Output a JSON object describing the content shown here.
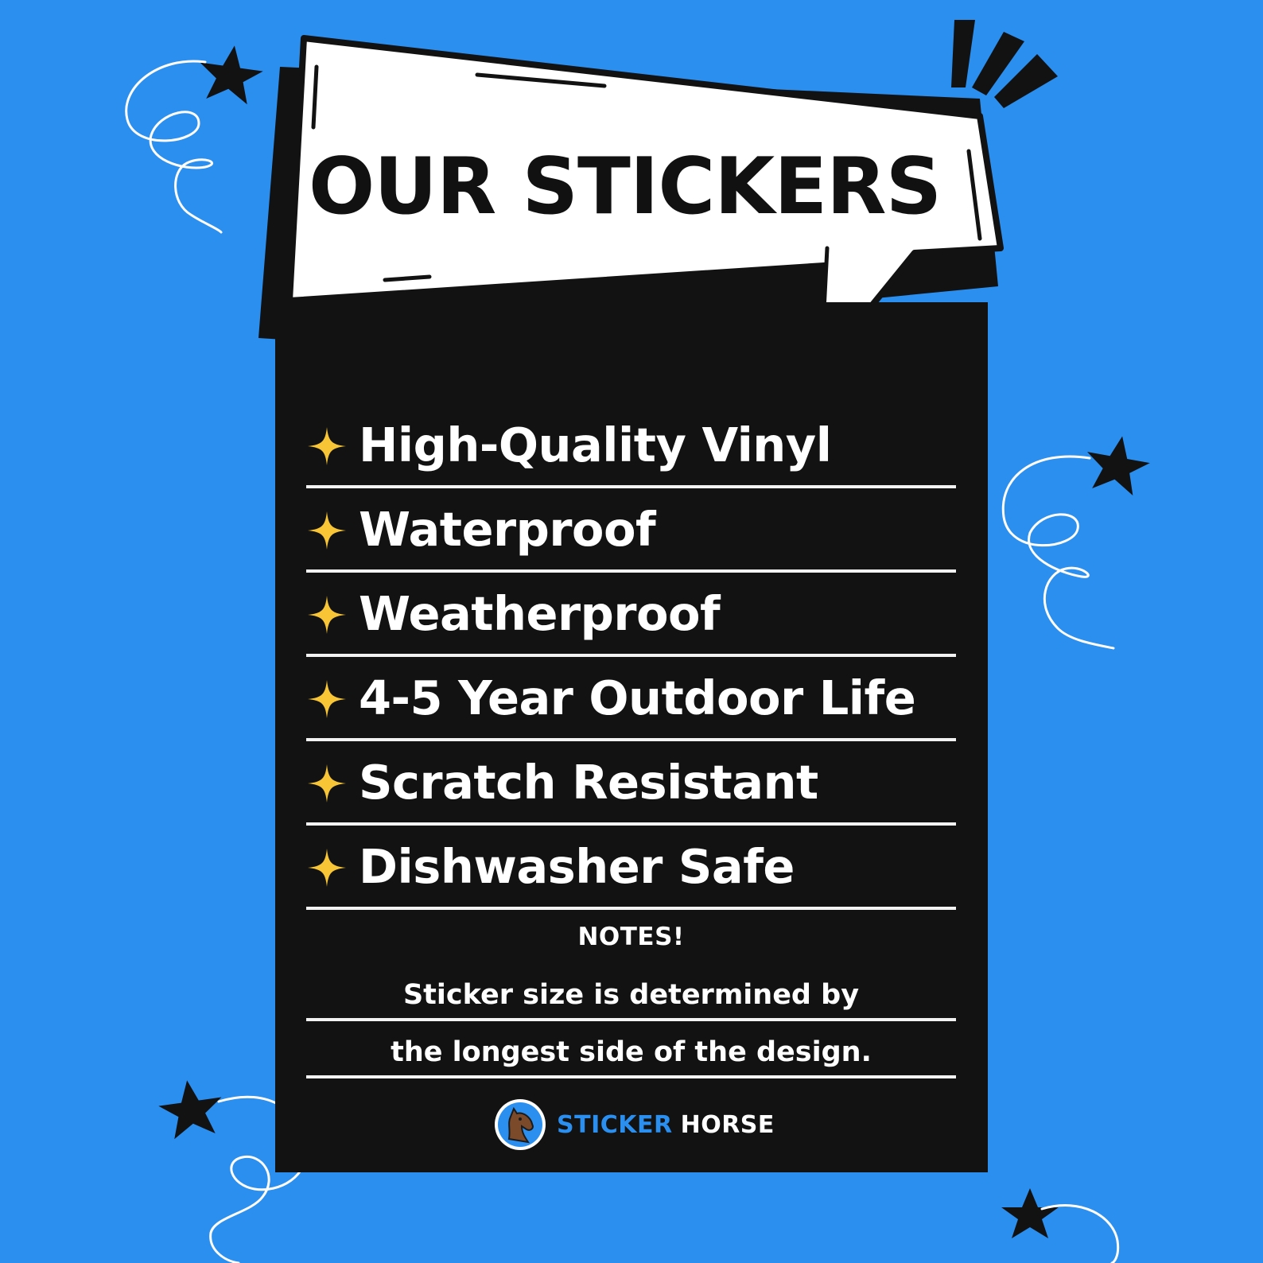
{
  "title": "OUR STICKERS",
  "features": [
    "High-Quality Vinyl",
    "Waterproof",
    "Weatherproof",
    "4-5 Year Outdoor Life",
    "Scratch Resistant",
    "Dishwasher Safe"
  ],
  "notes": {
    "heading": "NOTES!",
    "line1": "Sticker size is determined by",
    "line2": "the longest side of the design."
  },
  "brand": {
    "word1": "STICKER",
    "word2": "HORSE",
    "logo_icon": "horse-head-icon"
  },
  "colors": {
    "background": "#2b8ff0",
    "panel": "#121212",
    "bubble": "#ffffff",
    "accent_star": "#f7c536",
    "brand_blue": "#2b8ff0"
  }
}
